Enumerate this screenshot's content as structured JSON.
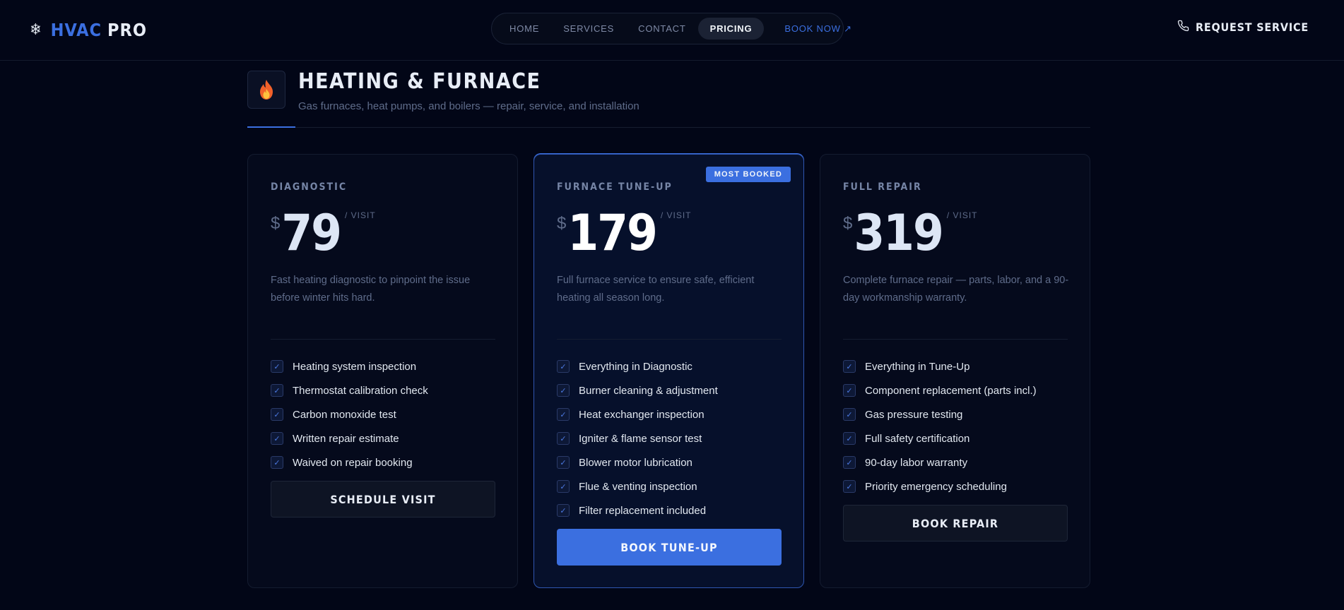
{
  "header": {
    "logo_accent": "HVAC",
    "logo_text": "PRO",
    "nav": [
      {
        "label": "HOME"
      },
      {
        "label": "SERVICES"
      },
      {
        "label": "CONTACT"
      },
      {
        "label": "PRICING",
        "active": true
      }
    ],
    "book_now": "BOOK NOW ↗",
    "request_service": "REQUEST SERVICE"
  },
  "section": {
    "icon": "flame-icon",
    "title": "HEATING & FURNACE",
    "subtitle": "Gas furnaces, heat pumps, and boilers — repair, service, and installation"
  },
  "colors": {
    "accent": "#3b6fe0",
    "background": "#020617"
  },
  "plans": [
    {
      "tier": "DIAGNOSTIC",
      "currency": "$",
      "price": "79",
      "unit": "/ VISIT",
      "description": "Fast heating diagnostic to pinpoint the issue before winter hits hard.",
      "features": [
        "Heating system inspection",
        "Thermostat calibration check",
        "Carbon monoxide test",
        "Written repair estimate",
        "Waived on repair booking"
      ],
      "button": "SCHEDULE VISIT"
    },
    {
      "tier": "FURNACE TUNE-UP",
      "badge": "MOST BOOKED",
      "currency": "$",
      "price": "179",
      "unit": "/ VISIT",
      "description": "Full furnace service to ensure safe, efficient heating all season long.",
      "features": [
        "Everything in Diagnostic",
        "Burner cleaning & adjustment",
        "Heat exchanger inspection",
        "Igniter & flame sensor test",
        "Blower motor lubrication",
        "Flue & venting inspection",
        "Filter replacement included"
      ],
      "button": "BOOK TUNE-UP"
    },
    {
      "tier": "FULL REPAIR",
      "currency": "$",
      "price": "319",
      "unit": "/ VISIT",
      "description": "Complete furnace repair — parts, labor, and a 90-day workmanship warranty.",
      "features": [
        "Everything in Tune-Up",
        "Component replacement (parts incl.)",
        "Gas pressure testing",
        "Full safety certification",
        "90-day labor warranty",
        "Priority emergency scheduling"
      ],
      "button": "BOOK REPAIR"
    }
  ]
}
